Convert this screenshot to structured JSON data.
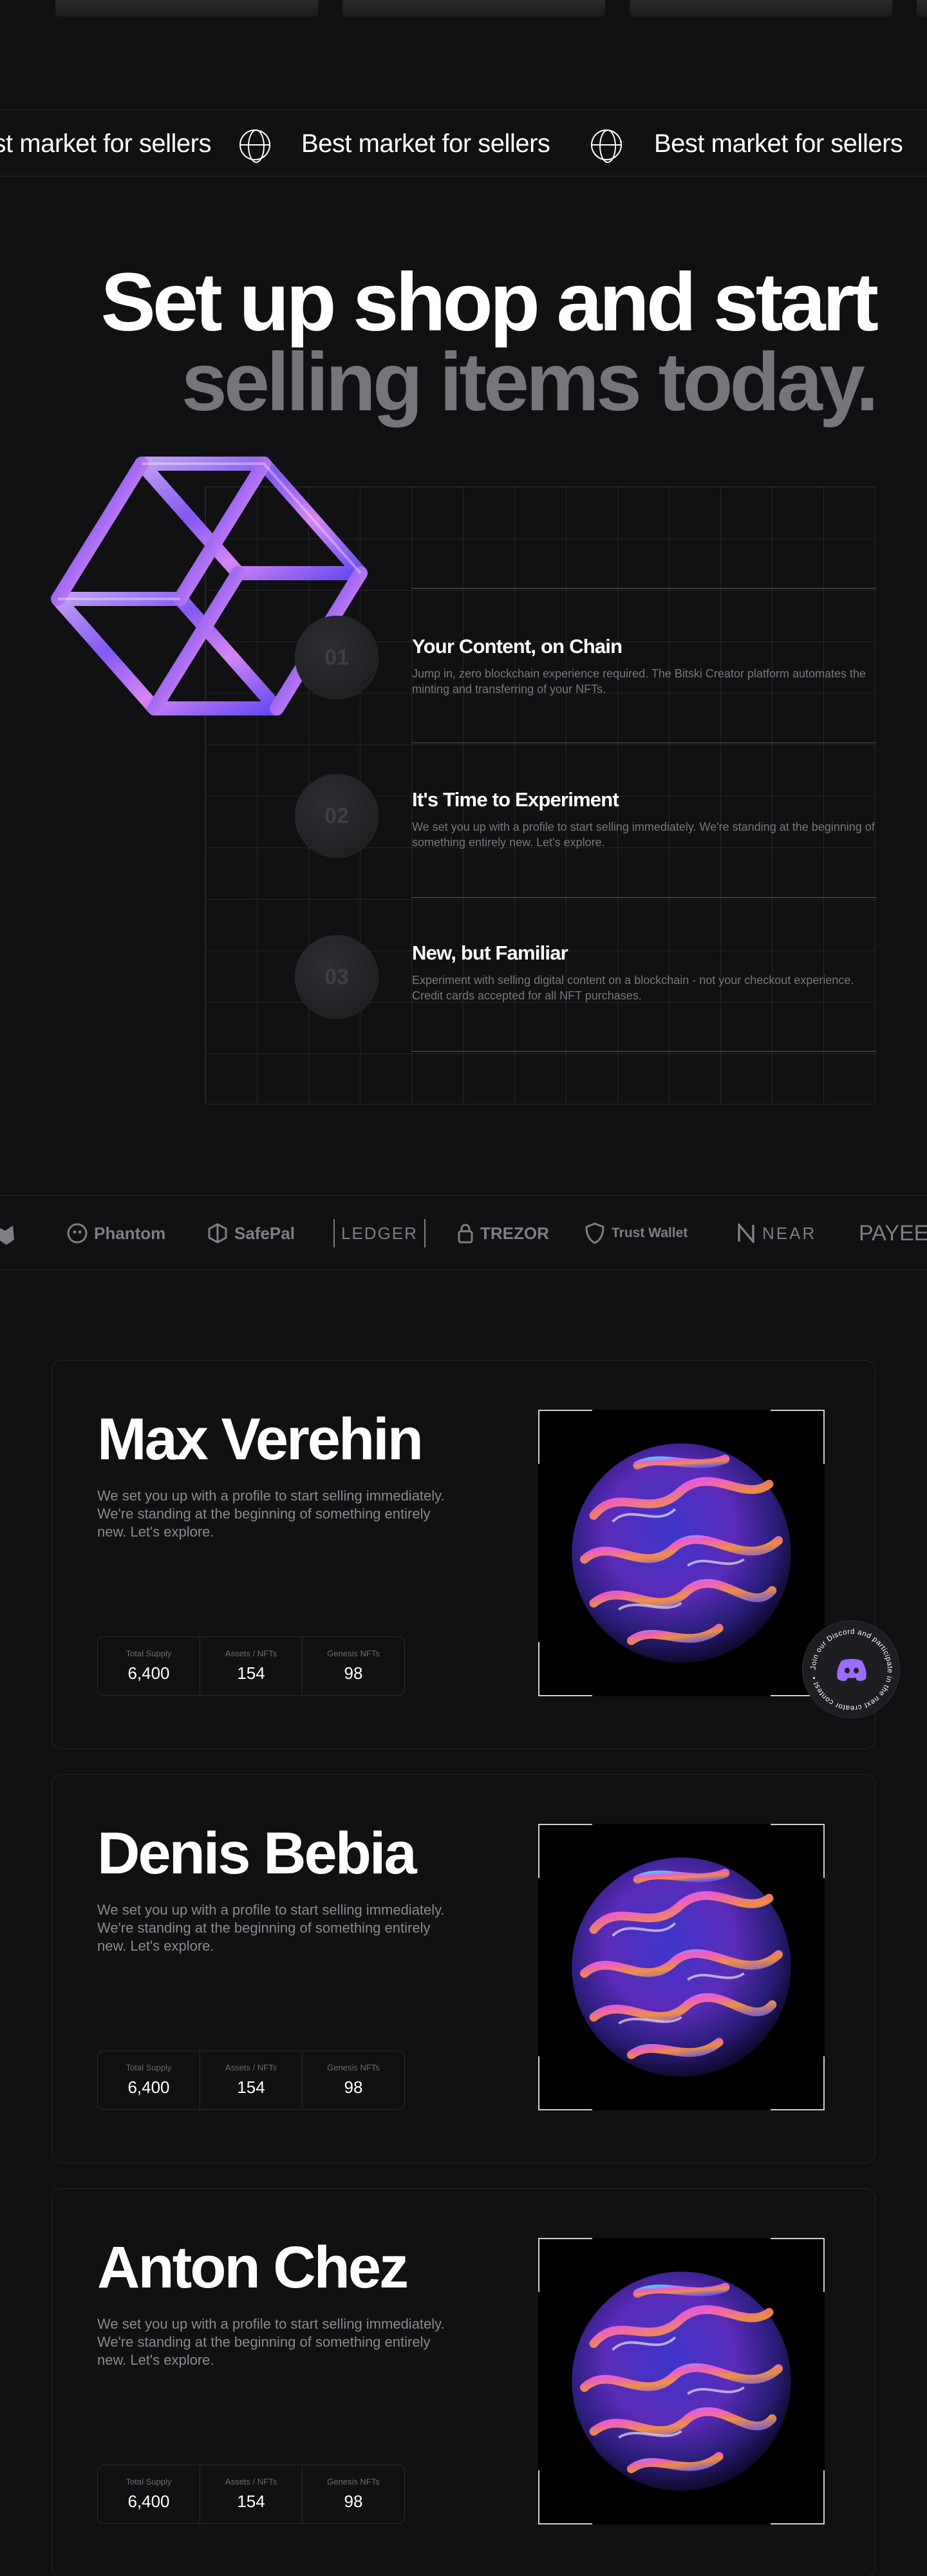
{
  "marquee": {
    "items": [
      "Best market for sellers",
      "Best market for sellers",
      "Best market for sellers"
    ]
  },
  "hero": {
    "line1": "Set up shop and start",
    "line2": "selling items today."
  },
  "features": [
    {
      "number": "01",
      "title": "Your Content, on Chain",
      "description": "Jump in, zero blockchain experience required. The Bitski Creator platform automates the minting and transferring of your NFTs."
    },
    {
      "number": "02",
      "title": "It's Time to Experiment",
      "description": "We set you up with a profile to start selling immediately. We're standing at the beginning of something entirely new. Let's explore."
    },
    {
      "number": "03",
      "title": "New, but Familiar",
      "description": "Experiment with selling digital content on a blockchain - not your checkout experience. Credit cards accepted for all NFT purchases."
    }
  ],
  "partners": [
    "Phantom",
    "SafePal",
    "LEDGER",
    "TREZOR",
    "Trust Wallet",
    "NEAR",
    "PAYEER"
  ],
  "creators": [
    {
      "name": "Max Verehin",
      "description": "We set you up with a profile to start selling immediately. We're standing at the beginning of something entirely new. Let's explore.",
      "stats": [
        {
          "label": "Total Supply",
          "value": "6,400"
        },
        {
          "label": "Assets / NFTs",
          "value": "154"
        },
        {
          "label": "Genesis NFTs",
          "value": "98"
        }
      ]
    },
    {
      "name": "Denis Bebia",
      "description": "We set you up with a profile to start selling immediately. We're standing at the beginning of something entirely new. Let's explore.",
      "stats": [
        {
          "label": "Total Supply",
          "value": "6,400"
        },
        {
          "label": "Assets / NFTs",
          "value": "154"
        },
        {
          "label": "Genesis NFTs",
          "value": "98"
        }
      ]
    },
    {
      "name": "Anton Chez",
      "description": "We set you up with a profile to start selling immediately. We're standing at the beginning of something entirely new. Let's explore.",
      "stats": [
        {
          "label": "Total Supply",
          "value": "6,400"
        },
        {
          "label": "Assets / NFTs",
          "value": "154"
        },
        {
          "label": "Genesis NFTs",
          "value": "98"
        }
      ]
    }
  ],
  "discord_badge": {
    "text": "Join our Discord and participate in the next creator contest • "
  },
  "colors": {
    "background": "#111113",
    "muted_text": "#75757b",
    "accent_purple": "#9b6cff"
  }
}
